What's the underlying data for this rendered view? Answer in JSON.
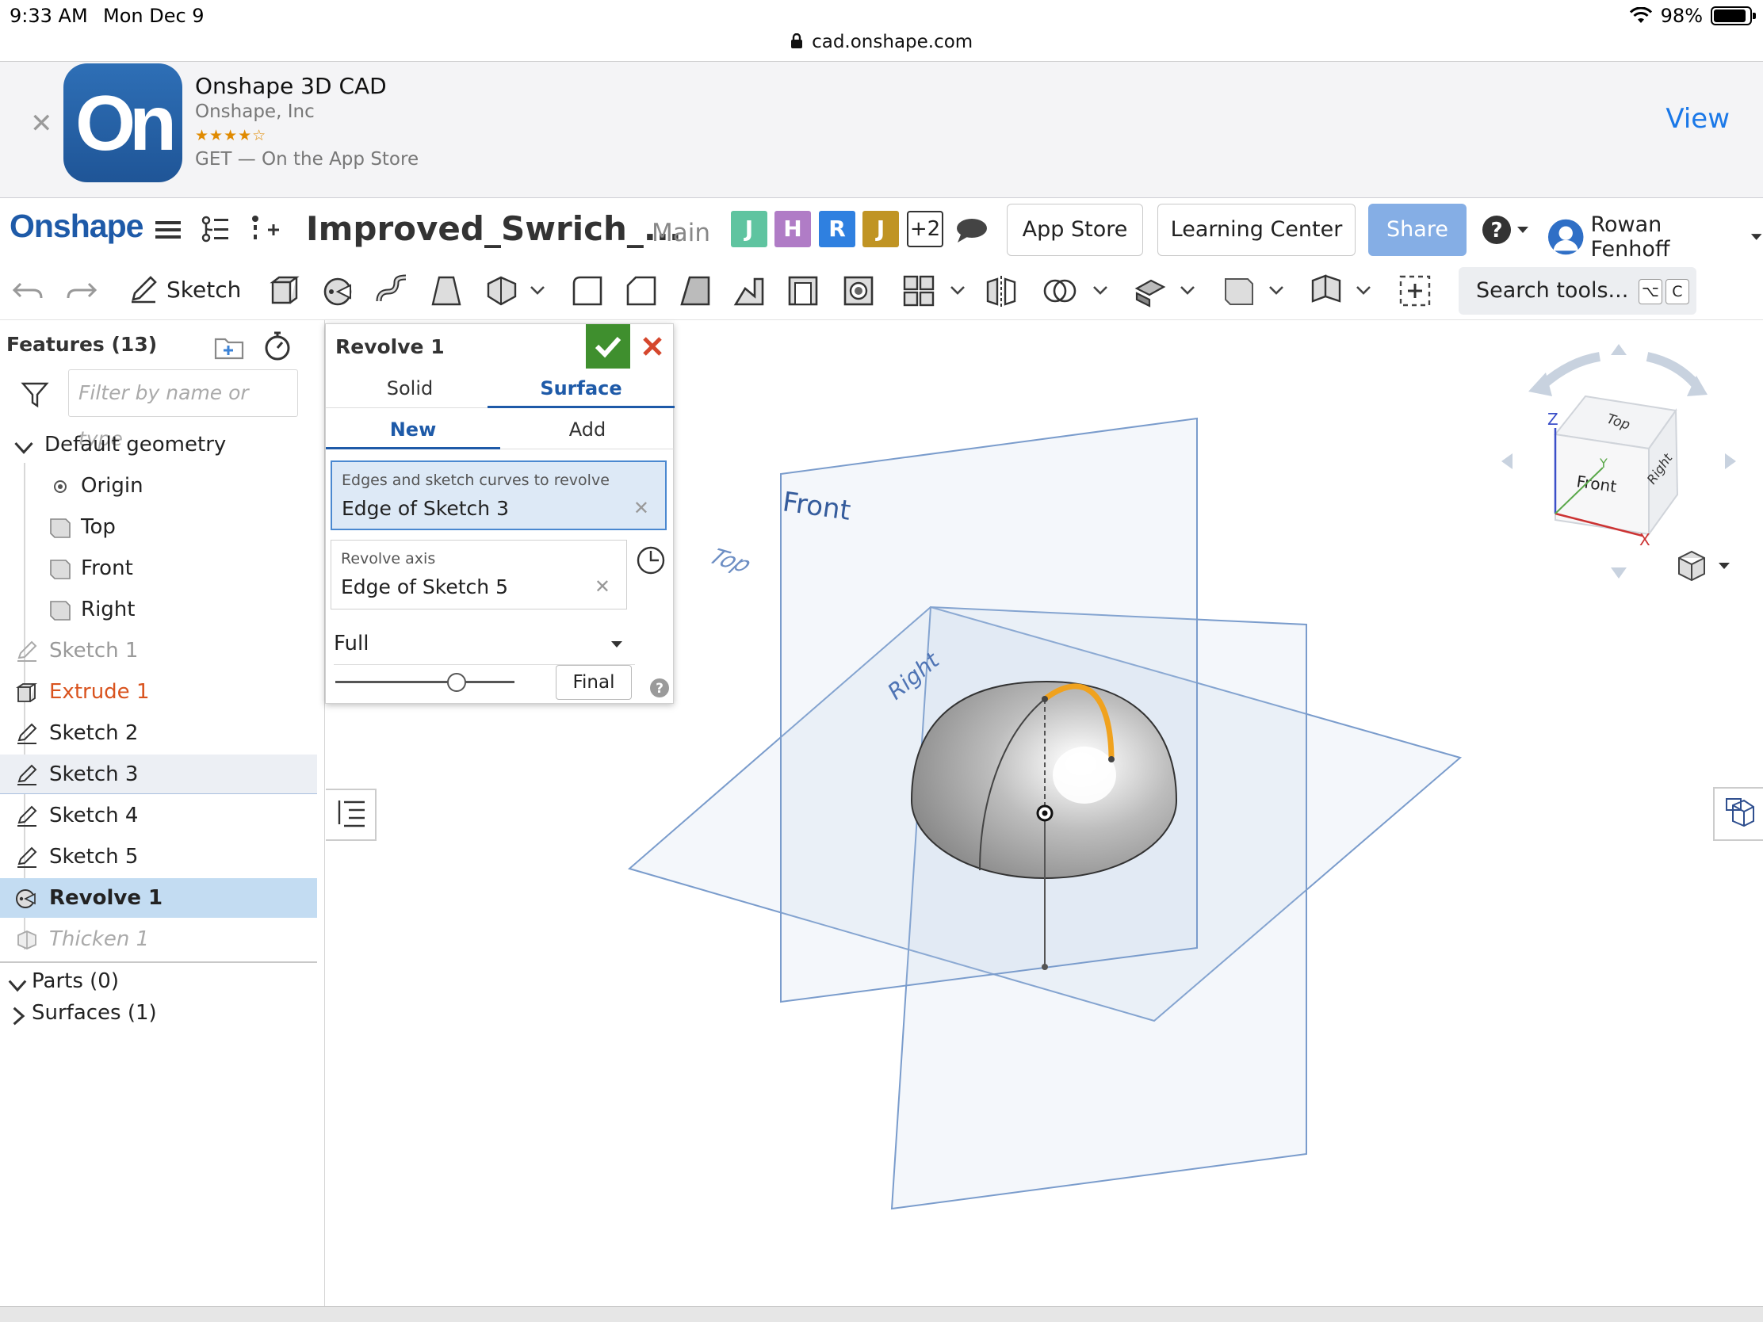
{
  "status_bar": {
    "time": "9:33 AM",
    "date": "Mon Dec 9",
    "battery": "98%"
  },
  "browser": {
    "url": "cad.onshape.com"
  },
  "app_banner": {
    "name": "Onshape 3D CAD",
    "company": "Onshape, Inc",
    "rating_stars": "★★★★☆",
    "get_text": "GET — On the App Store",
    "view_label": "View",
    "logo_text": "On"
  },
  "header": {
    "brand": "Onshape",
    "document_title": "Improved_Swrich_...",
    "branch": "Main",
    "collaborators": [
      {
        "initial": "J",
        "color": "#5fc4a0"
      },
      {
        "initial": "H",
        "color": "#b07cc6"
      },
      {
        "initial": "R",
        "color": "#2f80e0"
      },
      {
        "initial": "J",
        "color": "#c09424"
      }
    ],
    "more_collaborators": "+2",
    "app_store_label": "App Store",
    "learning_center_label": "Learning Center",
    "share_label": "Share",
    "help_label": "?",
    "user_name": "Rowan Fenhoff"
  },
  "toolbar": {
    "sketch_label": "Sketch",
    "search_placeholder": "Search tools...",
    "search_shortcut_1": "⌥",
    "search_shortcut_2": "C"
  },
  "feature_panel": {
    "title": "Features (13)",
    "filter_placeholder": "Filter by name or type",
    "default_geometry_label": "Default geometry",
    "default_geometry": [
      {
        "label": "Origin",
        "icon": "origin-icon"
      },
      {
        "label": "Top",
        "icon": "plane-icon"
      },
      {
        "label": "Front",
        "icon": "plane-icon"
      },
      {
        "label": "Right",
        "icon": "plane-icon"
      }
    ],
    "features": [
      {
        "label": "Sketch 1",
        "icon": "sketch-icon",
        "state": "suppressed"
      },
      {
        "label": "Extrude 1",
        "icon": "extrude-icon",
        "state": "error"
      },
      {
        "label": "Sketch 2",
        "icon": "sketch-icon",
        "state": "normal"
      },
      {
        "label": "Sketch 3",
        "icon": "sketch-icon",
        "state": "highlighted"
      },
      {
        "label": "Sketch 4",
        "icon": "sketch-icon",
        "state": "normal"
      },
      {
        "label": "Sketch 5",
        "icon": "sketch-icon",
        "state": "normal"
      },
      {
        "label": "Revolve 1",
        "icon": "revolve-icon",
        "state": "selected"
      },
      {
        "label": "Thicken 1",
        "icon": "thicken-icon",
        "state": "rolled-back"
      }
    ],
    "parts_label": "Parts (0)",
    "surfaces_label": "Surfaces (1)"
  },
  "revolve_dialog": {
    "title": "Revolve 1",
    "type_tabs": [
      "Solid",
      "Surface"
    ],
    "active_type": "Surface",
    "op_tabs": [
      "New",
      "Add"
    ],
    "active_op": "New",
    "edges_label": "Edges and sketch curves to revolve",
    "edges_value": "Edge of Sketch 3",
    "axis_label": "Revolve axis",
    "axis_value": "Edge of Sketch 5",
    "end_type": "Full",
    "final_label": "Final",
    "rollback_fraction": 0.7
  },
  "viewport": {
    "plane_labels": {
      "front": "Front",
      "top": "Top",
      "right": "Right"
    },
    "view_cube": {
      "top": "Top",
      "front": "Front",
      "right": "Right",
      "axis_x": "X",
      "axis_y": "Y",
      "axis_z": "Z"
    }
  },
  "colors": {
    "brand_blue": "#1e5aa8",
    "accept_green": "#3f8f2e",
    "cancel_red": "#d5472d",
    "error_orange": "#d9531e",
    "selected_row": "#c3dcf2",
    "plane_blue": "#7a9ccc",
    "highlight_curve": "#f0a21e"
  }
}
